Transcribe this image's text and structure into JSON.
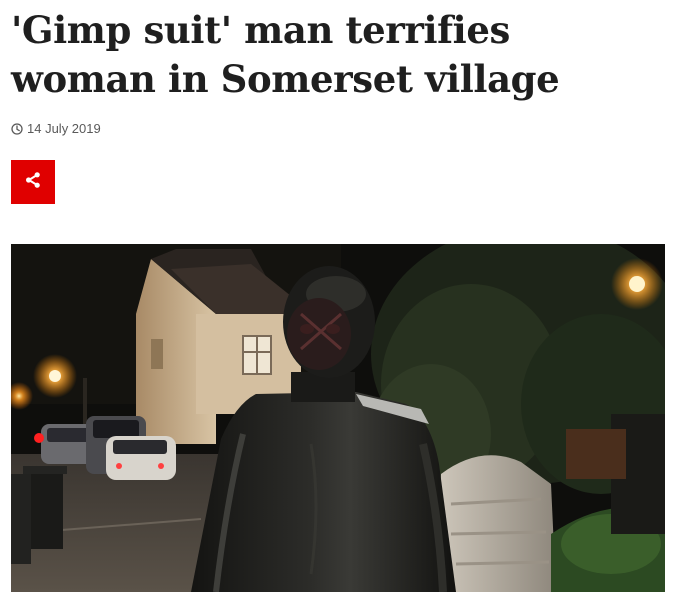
{
  "article": {
    "headline_line1": "'Gimp suit' man terrifies",
    "headline_line2": "woman in Somerset village",
    "date": "14 July 2019"
  },
  "icons": {
    "date_icon": "clock-icon",
    "share_icon": "share-icon"
  },
  "colors": {
    "share_button": "#e00000",
    "headline_text": "#1f1f1f",
    "date_text": "#5a5a5a"
  }
}
